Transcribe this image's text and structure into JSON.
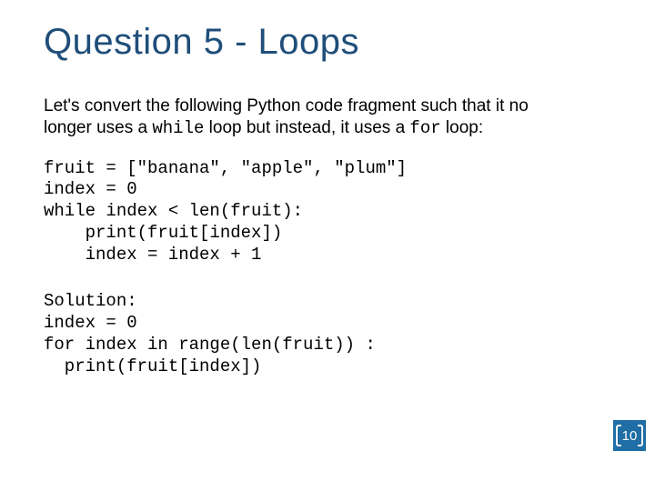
{
  "title": "Question 5 - Loops",
  "intro": {
    "part1": "Let's convert the following Python code fragment such that it no longer uses a ",
    "code1": "while",
    "part2": " loop but instead, it uses a ",
    "code2": "for",
    "part3": " loop:"
  },
  "code": "fruit = [\"banana\", \"apple\", \"plum\"]\nindex = 0\nwhile index < len(fruit):\n    print(fruit[index])\n    index = index + 1",
  "solution": "Solution:\nindex = 0\nfor index in range(len(fruit)) :\n  print(fruit[index])",
  "page_number": "10"
}
